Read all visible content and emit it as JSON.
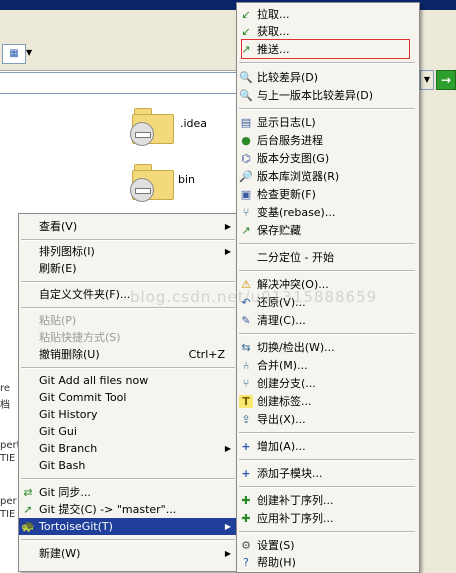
{
  "background": {
    "folders": [
      {
        "name": ".idea"
      },
      {
        "name": "bin"
      }
    ],
    "side_fragments": [
      "re",
      "档",
      "pert",
      "TIE",
      "per",
      "TIE"
    ],
    "watermark": "blog.csdn.net/u01315888659",
    "go_button": "→"
  },
  "context_menu": {
    "items": [
      {
        "label": "查看(V)",
        "submenu": true
      },
      {
        "label": "排列图标(I)",
        "submenu": true
      },
      {
        "label": "刷新(E)"
      },
      {
        "label": "自定义文件夹(F)..."
      },
      {
        "label": "粘贴(P)",
        "disabled": true
      },
      {
        "label": "粘贴快捷方式(S)",
        "disabled": true
      },
      {
        "label": "撤销删除(U)",
        "shortcut": "Ctrl+Z"
      },
      {
        "label": "Git Add all files now"
      },
      {
        "label": "Git Commit Tool"
      },
      {
        "label": "Git History"
      },
      {
        "label": "Git Gui"
      },
      {
        "label": "Git Branch",
        "submenu": true
      },
      {
        "label": "Git Bash"
      },
      {
        "label": "Git 同步..."
      },
      {
        "label": "Git 提交(C) -> \"master\"..."
      },
      {
        "label": "TortoiseGit(T)",
        "submenu": true,
        "selected": true
      },
      {
        "label": "新建(W)",
        "submenu": true
      }
    ]
  },
  "tortoise_menu": {
    "items": [
      {
        "label": "拉取...",
        "icon": "pull-icon"
      },
      {
        "label": "获取...",
        "icon": "fetch-icon"
      },
      {
        "label": "推送...",
        "icon": "push-icon",
        "highlighted": true
      },
      {
        "label": "比较差异(D)",
        "icon": "diff-icon"
      },
      {
        "label": "与上一版本比较差异(D)",
        "icon": "diff-prev-icon"
      },
      {
        "label": "显示日志(L)",
        "icon": "log-icon"
      },
      {
        "label": "后台服务进程",
        "icon": "daemon-icon"
      },
      {
        "label": "版本分支图(G)",
        "icon": "revision-graph-icon"
      },
      {
        "label": "版本库浏览器(R)",
        "icon": "repo-browser-icon"
      },
      {
        "label": "检查更新(F)",
        "icon": "check-updates-icon"
      },
      {
        "label": "变基(rebase)...",
        "icon": "rebase-icon"
      },
      {
        "label": "保存贮藏",
        "icon": "stash-icon"
      },
      {
        "label": "二分定位 - 开始",
        "icon": ""
      },
      {
        "label": "解决冲突(O)...",
        "icon": "resolve-icon"
      },
      {
        "label": "还原(V)...",
        "icon": "revert-icon"
      },
      {
        "label": "清理(C)...",
        "icon": "cleanup-icon"
      },
      {
        "label": "切换/检出(W)...",
        "icon": "switch-icon"
      },
      {
        "label": "合并(M)...",
        "icon": "merge-icon"
      },
      {
        "label": "创建分支(...",
        "icon": "branch-icon"
      },
      {
        "label": "创建标签...",
        "icon": "tag-icon"
      },
      {
        "label": "导出(X)...",
        "icon": "export-icon"
      },
      {
        "label": "增加(A)...",
        "icon": "add-icon"
      },
      {
        "label": "添加子模块...",
        "icon": "submodule-icon"
      },
      {
        "label": "创建补丁序列...",
        "icon": "create-patch-icon"
      },
      {
        "label": "应用补丁序列...",
        "icon": "apply-patch-icon"
      },
      {
        "label": "设置(S)",
        "icon": "settings-icon"
      },
      {
        "label": "帮助(H)",
        "icon": "help-icon"
      }
    ]
  },
  "colors": {
    "selection": "#1f3f9a",
    "highlight_border": "#e03030",
    "menu_bg": "#f5f4ee"
  }
}
